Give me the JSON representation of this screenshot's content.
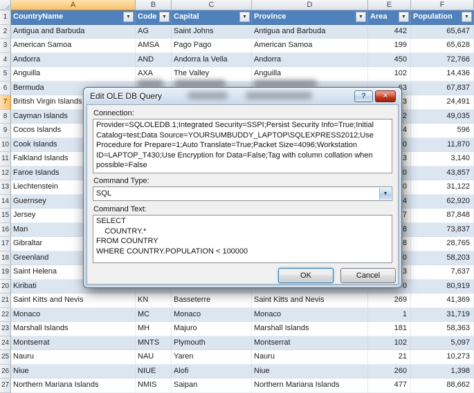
{
  "colors": {
    "table_header": "#4F81BD",
    "band_row": "#DCE6F1",
    "selection_amber": "#F8C26C",
    "close_button_red": "#C23E24"
  },
  "icons": {
    "filter_arrow": "▼",
    "dropdown_arrow": "▼"
  },
  "sheet": {
    "col_headers": [
      "A",
      "B",
      "C",
      "D",
      "E",
      "F"
    ],
    "selected_col": "A",
    "selected_row": 7,
    "header_labels": [
      "CountryName",
      "Code",
      "Capital",
      "Province",
      "Area",
      "Population"
    ],
    "rows": [
      {
        "n": 2,
        "cells": [
          "Antigua and Barbuda",
          "AG",
          "Saint Johns",
          "Antigua and Barbuda",
          "442",
          "65,647"
        ]
      },
      {
        "n": 3,
        "cells": [
          "American Samoa",
          "AMSA",
          "Pago Pago",
          "American Samoa",
          "199",
          "65,628"
        ]
      },
      {
        "n": 4,
        "cells": [
          "Andorra",
          "AND",
          "Andorra la Vella",
          "Andorra",
          "450",
          "72,766"
        ]
      },
      {
        "n": 5,
        "cells": [
          "Anguilla",
          "AXA",
          "The Valley",
          "Anguilla",
          "102",
          "14,436"
        ]
      },
      {
        "n": 6,
        "cells": [
          "Bermuda",
          "",
          "",
          "",
          "63",
          "67,837"
        ]
      },
      {
        "n": 7,
        "cells": [
          "British Virgin Islands",
          "",
          "",
          "",
          "3",
          "24,491"
        ]
      },
      {
        "n": 8,
        "cells": [
          "Cayman Islands",
          "",
          "",
          "",
          "2",
          "49,035"
        ]
      },
      {
        "n": 9,
        "cells": [
          "Cocos Islands",
          "",
          "",
          "",
          "4",
          "596"
        ]
      },
      {
        "n": 10,
        "cells": [
          "Cook Islands",
          "",
          "",
          "",
          "0",
          "11,870"
        ]
      },
      {
        "n": 11,
        "cells": [
          "Falkland Islands",
          "",
          "",
          "",
          "3",
          "3,140"
        ]
      },
      {
        "n": 12,
        "cells": [
          "Faroe Islands",
          "",
          "",
          "",
          "0",
          "43,857"
        ]
      },
      {
        "n": 13,
        "cells": [
          "Liechtenstein",
          "",
          "",
          "",
          "0",
          "31,122"
        ]
      },
      {
        "n": 14,
        "cells": [
          "Guernsey",
          "",
          "",
          "",
          "4",
          "62,920"
        ]
      },
      {
        "n": 15,
        "cells": [
          "Jersey",
          "",
          "",
          "",
          "7",
          "87,848"
        ]
      },
      {
        "n": 16,
        "cells": [
          "Man",
          "",
          "",
          "",
          "8",
          "73,837"
        ]
      },
      {
        "n": 17,
        "cells": [
          "Gibraltar",
          "",
          "",
          "",
          "8",
          "28,765"
        ]
      },
      {
        "n": 18,
        "cells": [
          "Greenland",
          "",
          "",
          "",
          "0",
          "58,203"
        ]
      },
      {
        "n": 19,
        "cells": [
          "Saint Helena",
          "",
          "",
          "",
          "3",
          "7,637"
        ]
      },
      {
        "n": 20,
        "cells": [
          "Kiribati",
          "",
          "",
          "",
          "0",
          "80,919"
        ]
      },
      {
        "n": 21,
        "cells": [
          "Saint Kitts and Nevis",
          "KN",
          "Basseterre",
          "Saint Kitts and Nevis",
          "269",
          "41,369"
        ]
      },
      {
        "n": 22,
        "cells": [
          "Monaco",
          "MC",
          "Monaco",
          "Monaco",
          "1",
          "31,719"
        ]
      },
      {
        "n": 23,
        "cells": [
          "Marshall Islands",
          "MH",
          "Majuro",
          "Marshall Islands",
          "181",
          "58,363"
        ]
      },
      {
        "n": 24,
        "cells": [
          "Montserrat",
          "MNTS",
          "Plymouth",
          "Montserrat",
          "102",
          "5,097"
        ]
      },
      {
        "n": 25,
        "cells": [
          "Nauru",
          "NAU",
          "Yaren",
          "Nauru",
          "21",
          "10,273"
        ]
      },
      {
        "n": 26,
        "cells": [
          "Niue",
          "NIUE",
          "Alofi",
          "Niue",
          "260",
          "1,398"
        ]
      },
      {
        "n": 27,
        "cells": [
          "Northern Mariana Islands",
          "NMIS",
          "Saipan",
          "Northern Mariana Islands",
          "477",
          "88,662"
        ]
      }
    ]
  },
  "dialog": {
    "title": "Edit OLE DB Query",
    "help_glyph": "?",
    "close_glyph": "✕",
    "connection_label": "Connection:",
    "connection_text": "Provider=SQLOLEDB.1;Integrated Security=SSPI;Persist Security Info=True;Initial Catalog=test;Data Source=YOURSUMBUDDY_LAPTOP\\SQLEXPRESS2012;Use Procedure for Prepare=1;Auto Translate=True;Packet Size=4096;Workstation ID=LAPTOP_T430;Use Encryption for Data=False;Tag with column collation when possible=False",
    "command_type_label": "Command Type:",
    "command_type_value": "SQL",
    "command_text_label": "Command Text:",
    "command_text": "SELECT\n    COUNTRY.*\nFROM COUNTRY\nWHERE COUNTRY.POPULATION < 100000",
    "ok_label": "OK",
    "cancel_label": "Cancel"
  }
}
